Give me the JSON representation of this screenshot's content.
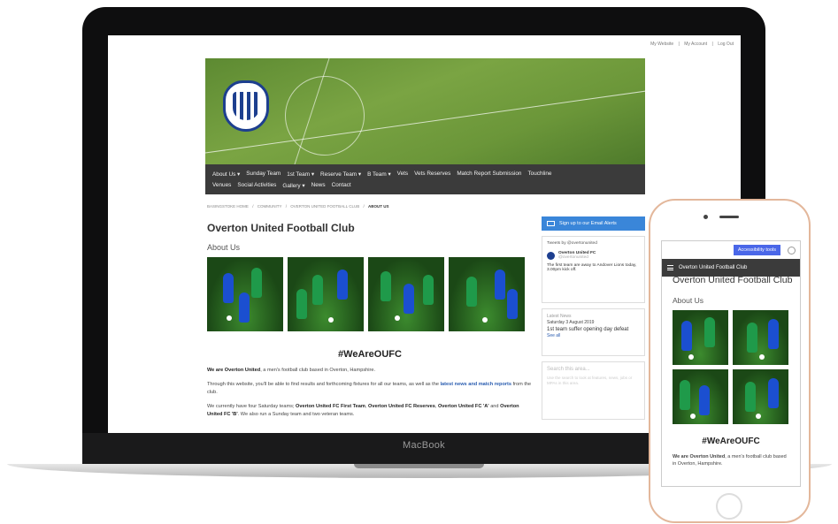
{
  "laptop": {
    "brand": "MacBook",
    "top_links": [
      "My Website",
      "|",
      "My Account",
      "|",
      "Log Out"
    ],
    "nav_row1": [
      "About Us ▾",
      "Sunday Team",
      "1st Team ▾",
      "Reserve Team ▾",
      "B Team ▾",
      "Vets",
      "Vets Reserves",
      "Match Report Submission",
      "Touchline"
    ],
    "nav_row2": [
      "Venues",
      "Social Activities",
      "Gallery ▾",
      "News",
      "Contact"
    ],
    "breadcrumbs": [
      "BASINGSTOKE HOME",
      "/",
      "COMMUNITY",
      "/",
      "OVERTON UNITED FOOTBALL CLUB",
      "/",
      "ABOUT US"
    ],
    "page_title": "Overton United Football Club",
    "section_title": "About Us",
    "hashtag": "#WeAreOUFC",
    "para1_bold": "We are Overton United",
    "para1_rest": ", a men's football club based in Overton, Hampshire.",
    "para2_start": "Through this website, you'll be able to find results and forthcoming fixtures for all our teams, as well as the",
    "para2_link": "latest news and match reports",
    "para2_end": "from the club.",
    "para3_start": "We currently have four Saturday teams;",
    "para3_b1": "Overton United FC First Team",
    "para3_b2": "Overton United FC Reserves",
    "para3_b3": "Overton United FC 'A'",
    "para3_and": "and",
    "para3_b4": "Overton United FC 'B'",
    "para3_end": ". We also run a Sunday team and two veteran teams.",
    "sidebar": {
      "signup": "Sign up to our Email Alerts",
      "tweets_header": "Tweets by @overtonunited",
      "tweet_name": "Overton United FC",
      "tweet_handle": "@overtonunited",
      "tweet_text": "The first team are away to Andover Lions today, 3.00pm kick off.",
      "news_label": "Latest News",
      "news_date": "Saturday 3 August 2019",
      "news_title": "1st team suffer opening day defeat",
      "news_link": "See all",
      "search_placeholder": "Search this area...",
      "search_sub": "Use the search to look at features, news, jobs or MPAs in this area."
    }
  },
  "phone": {
    "accessibility": "Accessibility tools",
    "nav_title": "Overton United Football Club",
    "page_title": "Overton United Football Club",
    "section_title": "About Us",
    "hashtag": "#WeAreOUFC",
    "para_bold": "We are Overton United",
    "para_rest": ", a men's football club based in Overton, Hampshire."
  },
  "colors": {
    "nav_bg": "#3b3b3b",
    "signup_bg": "#3a86d9",
    "accessibility_bg": "#4a67e8",
    "home_kit": "#1b4fd0",
    "away_kit": "#1f9a4a"
  }
}
